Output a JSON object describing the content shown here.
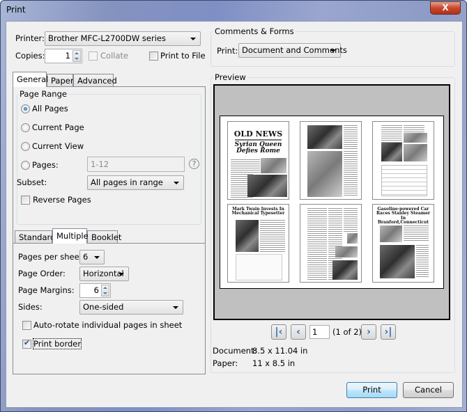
{
  "window": {
    "title": "Print",
    "close_label": "X"
  },
  "printer": {
    "label": "Printer:",
    "value": "Brother MFC-L2700DW series"
  },
  "copies": {
    "label": "Copies:",
    "value": "1",
    "collate_label": "Collate",
    "collate_checked": false,
    "print_to_file_label": "Print to File",
    "print_to_file_checked": false
  },
  "top_tabs": [
    {
      "label": "General",
      "active": true
    },
    {
      "label": "Paper",
      "active": false
    },
    {
      "label": "Advanced",
      "active": false
    }
  ],
  "page_range": {
    "title": "Page Range",
    "options": [
      {
        "label": "All Pages",
        "selected": true
      },
      {
        "label": "Current Page",
        "selected": false
      },
      {
        "label": "Current View",
        "selected": false
      },
      {
        "label": "Pages:",
        "selected": false
      }
    ],
    "pages_value": "1-12",
    "help_icon": "?",
    "subset_label": "Subset:",
    "subset_value": "All pages in range",
    "reverse_label": "Reverse Pages",
    "reverse_checked": false
  },
  "layout_tabs": [
    {
      "label": "Standard",
      "active": false
    },
    {
      "label": "Multiple",
      "active": true
    },
    {
      "label": "Booklet",
      "active": false
    }
  ],
  "multiple": {
    "pages_per_sheet_label": "Pages per sheet:",
    "pages_per_sheet_value": "6",
    "page_order_label": "Page Order:",
    "page_order_value": "Horizontal",
    "page_margins_label": "Page Margins:",
    "page_margins_value": "6",
    "sides_label": "Sides:",
    "sides_value": "One-sided",
    "auto_rotate_label": "Auto-rotate individual pages in sheet",
    "auto_rotate_checked": false,
    "print_border_label": "Print border",
    "print_border_checked": true
  },
  "comments_forms": {
    "title": "Comments & Forms",
    "print_label": "Print:",
    "print_value": "Document and Comments"
  },
  "preview": {
    "title": "Preview",
    "pages": [
      {
        "headline": "OLD NEWS",
        "subhead": "Syrian Queen Defies Rome"
      },
      {
        "headline": "",
        "subhead": ""
      },
      {
        "headline": "",
        "subhead": ""
      },
      {
        "headline": "Mark Twain Invests In Mechanical Typesetter",
        "subhead": ""
      },
      {
        "headline": "",
        "subhead": ""
      },
      {
        "headline": "Gasoline-powered Car Races Stanley Steamer In Branford,Connecticut",
        "subhead": ""
      }
    ],
    "nav": {
      "first_icon": "first-page",
      "prev_icon": "previous-page",
      "current_page": "1",
      "page_of": "(1 of 2)",
      "next_icon": "next-page",
      "last_icon": "last-page"
    },
    "document_label": "Document:",
    "document_value": "8.5 x 11.04 in",
    "paper_label": "Paper:",
    "paper_value": "11 x 8.5 in"
  },
  "buttons": {
    "print": "Print",
    "cancel": "Cancel"
  }
}
